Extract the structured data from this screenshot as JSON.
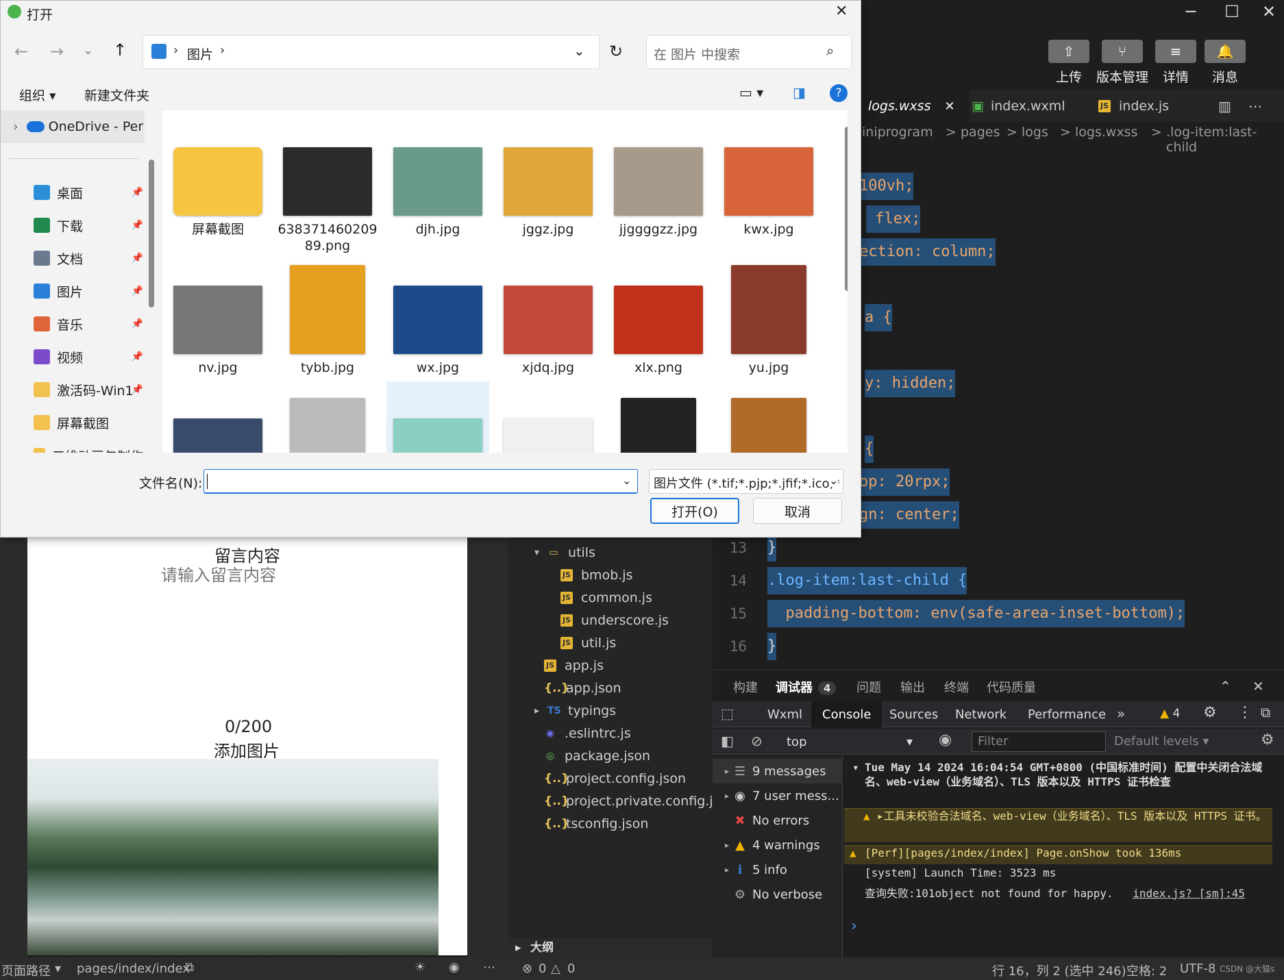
{
  "window": {
    "minimize": "─",
    "maximize": "☐",
    "close": "✕"
  },
  "top_toolbar": [
    {
      "label": "上传",
      "icon": "upload-icon",
      "glyph": "⇧"
    },
    {
      "label": "版本管理",
      "icon": "branch-icon",
      "glyph": "⑂"
    },
    {
      "label": "详情",
      "icon": "menu-icon",
      "glyph": "≡"
    },
    {
      "label": "消息",
      "icon": "bell-icon",
      "glyph": "🔔"
    }
  ],
  "editor_tabs": [
    {
      "label": "logs.wxss",
      "close": "✕"
    },
    {
      "label": "index.wxml"
    },
    {
      "label": "index.js"
    }
  ],
  "breadcrumb": {
    "parts": [
      "iniprogram",
      "pages",
      "logs",
      "logs.wxss",
      ".log-item:last-child"
    ],
    "sep": ">"
  },
  "code_lines": [
    {
      "text": "100vh;"
    },
    {
      "text": " flex;"
    },
    {
      "text": "ection: column;"
    },
    {
      "text": "a {"
    },
    {
      "text": "y: hidden;"
    },
    {
      "text": "{"
    },
    {
      "text": "op: 20rpx;"
    },
    {
      "text": "gn: center;"
    },
    {
      "num": "13",
      "text": "}"
    },
    {
      "num": "14",
      "text": ".log-item:last-child {"
    },
    {
      "num": "15",
      "text": "  padding-bottom: env(safe-area-inset-bottom);"
    },
    {
      "num": "16",
      "text": "}"
    }
  ],
  "simulator": {
    "message_label": "留言内容",
    "message_placeholder": "请输入留言内容",
    "counter": "0/200",
    "add_image": "添加图片"
  },
  "file_tree": [
    {
      "label": "utils",
      "type": "folder",
      "arrow": "▾"
    },
    {
      "label": "bmob.js",
      "type": "js"
    },
    {
      "label": "common.js",
      "type": "js"
    },
    {
      "label": "underscore.js",
      "type": "js"
    },
    {
      "label": "util.js",
      "type": "js"
    },
    {
      "label": "app.js",
      "type": "js"
    },
    {
      "label": "app.json",
      "type": "json"
    },
    {
      "label": "typings",
      "type": "ts-folder",
      "arrow": "▸"
    },
    {
      "label": ".eslintrc.js",
      "type": "eslint"
    },
    {
      "label": "package.json",
      "type": "npm"
    },
    {
      "label": "project.config.json",
      "type": "json"
    },
    {
      "label": "project.private.config.js...",
      "type": "json"
    },
    {
      "label": "tsconfig.json",
      "type": "json"
    }
  ],
  "outline_label": "大纲",
  "panel_tabs": [
    {
      "label": "构建"
    },
    {
      "label": "调试器",
      "badge": "4"
    },
    {
      "label": "问题"
    },
    {
      "label": "输出"
    },
    {
      "label": "终端"
    },
    {
      "label": "代码质量"
    }
  ],
  "devtools_tabs": [
    "Wxml",
    "Console",
    "Sources",
    "Network",
    "Performance"
  ],
  "devtools_more": "»",
  "warning_count": "4",
  "console_toolbar": {
    "context": "top",
    "filter_placeholder": "Filter",
    "levels": "Default levels"
  },
  "console_sidebar": [
    {
      "label": "9 messages",
      "icon": "list-icon"
    },
    {
      "label": "7 user mess...",
      "icon": "user-icon"
    },
    {
      "label": "No errors",
      "icon": "error-icon"
    },
    {
      "label": "4 warnings",
      "icon": "warning-icon"
    },
    {
      "label": "5 info",
      "icon": "info-icon"
    },
    {
      "label": "No verbose",
      "icon": "gear-icon"
    }
  ],
  "console_logs": [
    {
      "text": "Tue May 14 2024 16:04:54 GMT+0800 (中国标准时间) 配置中关闭合法域名、web-view（业务域名）、TLS 版本以及 HTTPS 证书检查",
      "level": "plain"
    },
    {
      "text": "▸工具未校验合法域名、web-view（业务域名）、TLS 版本以及 HTTPS 证书。",
      "level": "warn"
    },
    {
      "text": "[Perf][pages/index/index] Page.onShow took 136ms",
      "level": "warn"
    },
    {
      "text": "[system] Launch Time: 3523 ms",
      "level": "plain"
    },
    {
      "text": "查询失败:101object not found for happy.",
      "level": "plain",
      "link": "index.js? [sm]:45"
    }
  ],
  "console_prompt": "›",
  "status_bar": {
    "page_path_label": "页面路径",
    "page_path": "pages/index/index",
    "errors": "0",
    "warnings": "0",
    "cursor": "行 16，列 2 (选中 246)",
    "indent": "空格: 2",
    "encoding": "UTF-8",
    "watermark": "CSDN @大猫s"
  },
  "dialog": {
    "title": "打开",
    "location": "图片",
    "search_placeholder": "在 图片 中搜索",
    "organize": "组织",
    "new_folder": "新建文件夹",
    "onedrive": "OneDrive - Per",
    "quick_access": [
      {
        "label": "桌面",
        "color": "#2a8fd8"
      },
      {
        "label": "下载",
        "color": "#1f8a4c"
      },
      {
        "label": "文档",
        "color": "#6b7a8f"
      },
      {
        "label": "图片",
        "color": "#2a7fd8"
      },
      {
        "label": "音乐",
        "color": "#e0643a"
      },
      {
        "label": "视频",
        "color": "#7b4bc9"
      },
      {
        "label": "激活码-Win1",
        "color": "#f2c14e"
      },
      {
        "label": "屏幕截图",
        "color": "#f2c14e"
      },
      {
        "label": "三维动画与制作",
        "color": "#f2c14e"
      }
    ],
    "files": [
      {
        "name": "屏幕截图",
        "color": "#f5c542"
      },
      {
        "name": "638371460209 89.png",
        "color": "#2b2b2b"
      },
      {
        "name": "djh.jpg",
        "color": "#6a9a8a"
      },
      {
        "name": "jggz.jpg",
        "color": "#e0a63a"
      },
      {
        "name": "jjggggzz.jpg",
        "color": "#a89a8a"
      },
      {
        "name": "kwx.jpg",
        "color": "#d8643a"
      },
      {
        "name": "nv.jpg",
        "color": "#777"
      },
      {
        "name": "tybb.jpg",
        "color": "#e6a020"
      },
      {
        "name": "wx.jpg",
        "color": "#1a4a8a"
      },
      {
        "name": "xjdq.jpg",
        "color": "#c0493a"
      },
      {
        "name": "xlx.png",
        "color": "#c0301a"
      },
      {
        "name": "yu.jpg",
        "color": "#8a3a2a"
      },
      {
        "name": "",
        "color": "#3a4a6a"
      },
      {
        "name": "",
        "color": "#bbbbbb"
      },
      {
        "name": "",
        "color": "#8ad0c0"
      },
      {
        "name": "",
        "color": "#f0f0f0"
      },
      {
        "name": "",
        "color": "#222"
      },
      {
        "name": "",
        "color": "#b06a2a"
      }
    ],
    "filename_label": "文件名(N):",
    "filename_value": "",
    "filetype": "图片文件 (*.tif;*.pjp;*.jfif;*.ico;*",
    "open_button": "打开(O)",
    "cancel_button": "取消"
  }
}
